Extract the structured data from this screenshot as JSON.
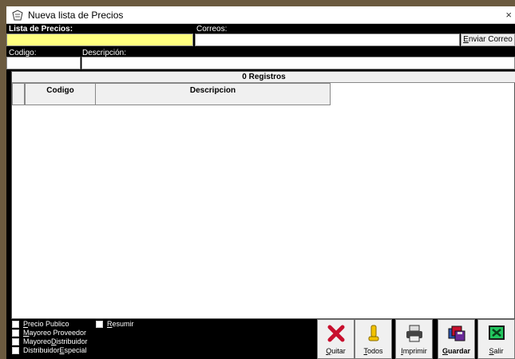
{
  "window": {
    "title": "Nueva lista de Precios",
    "close_glyph": "×"
  },
  "form": {
    "lista_label": "Lista de Precios:",
    "lista_value": "",
    "correos_label": "Correos:",
    "correos_value": "",
    "enviar_prefix": "E",
    "enviar_rest": "nviar Correo",
    "codigo_label": "Codigo:",
    "codigo_value": "",
    "descripcion_label": "Descripción:",
    "descripcion_value": ""
  },
  "grid": {
    "record_count": "0 Registros",
    "columns": [
      "Codigo",
      "Descripcion"
    ]
  },
  "options": {
    "precio_publico": {
      "u": "P",
      "rest": "recio Publico"
    },
    "mayoreo_proveedor": {
      "u": "M",
      "rest": "ayoreo Proveedor"
    },
    "mayoreo_distribuidor": {
      "pre": "Mayoreo ",
      "u": "D",
      "rest": "istribuidor"
    },
    "distribuidor_especial": {
      "pre": "Distribuidor ",
      "u": "E",
      "rest": "special"
    },
    "resumir": {
      "u": "R",
      "rest": "esumir"
    }
  },
  "toolbar": {
    "quitar": {
      "u": "Q",
      "rest": "uitar"
    },
    "todos": {
      "u": "T",
      "rest": "odos"
    },
    "imprimir": {
      "u": "I",
      "rest": "mprimir"
    },
    "guardar": {
      "u": "G",
      "rest": "uardar"
    },
    "salir": {
      "u": "S",
      "rest": "alir"
    }
  },
  "icons": {
    "app": "price-list-icon",
    "quitar": "red-x-icon",
    "todos": "yellow-tube-icon",
    "imprimir": "printer-icon",
    "guardar": "floppy-disks-icon",
    "salir": "green-exit-icon"
  }
}
